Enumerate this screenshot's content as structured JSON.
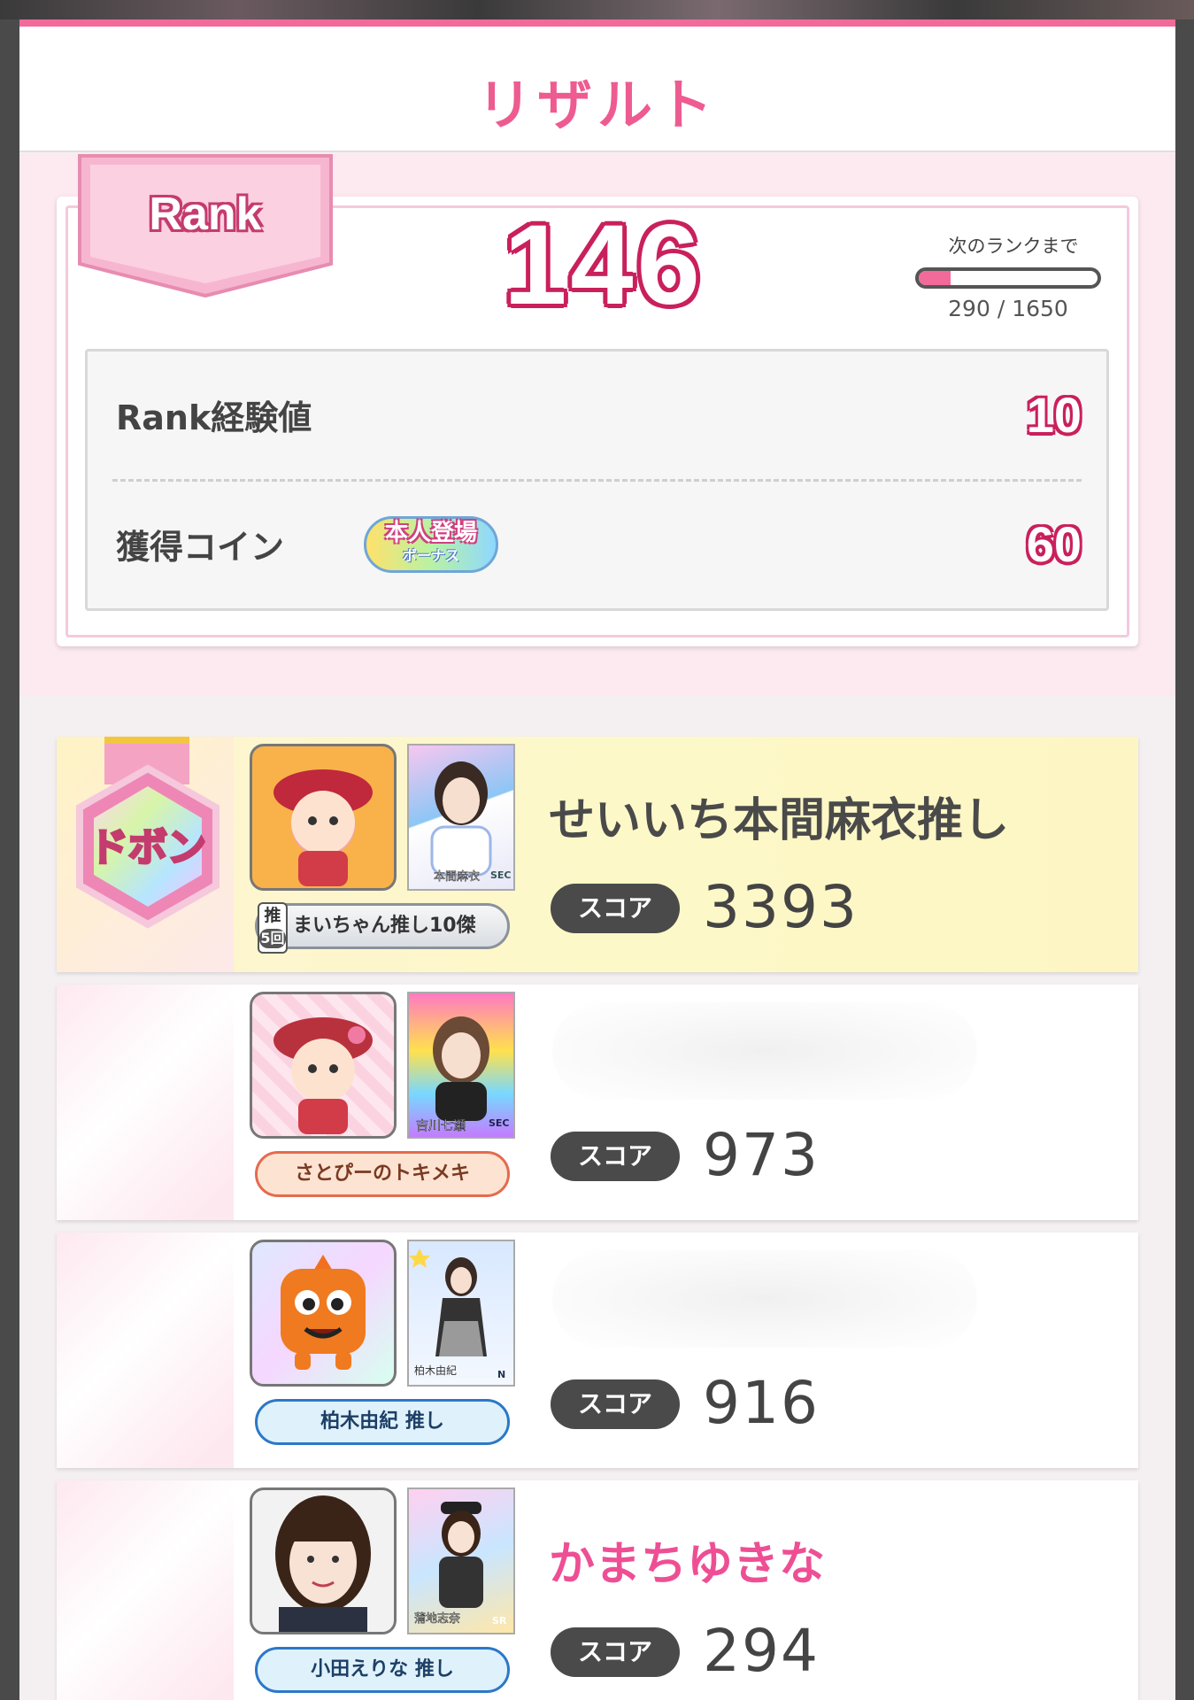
{
  "header": {
    "title": "リザルト"
  },
  "rank": {
    "badge_label": "Rank",
    "value": "146",
    "next_label": "次のランクまで",
    "next_progress": "290 / 1650",
    "next_fraction": 0.176
  },
  "stats": {
    "exp_label": "Rank経験値",
    "exp_value": "10",
    "coin_label": "獲得コイン",
    "bonus_top": "本人登場",
    "bonus_bottom": "ボーナス",
    "coin_value": "60"
  },
  "players": [
    {
      "medal": "ドボン",
      "name": "せいいち本間麻衣推し",
      "score_label": "スコア",
      "score": "3393",
      "oshi_tag": "まいちゃん推し10傑",
      "oshi_mark": "推",
      "oshi_count": "5回",
      "card_label": "本間麻衣",
      "card_rarity": "SEC"
    },
    {
      "name": "",
      "score_label": "スコア",
      "score": "973",
      "oshi_tag": "さとぴーのトキメキ",
      "card_label": "吉川七瀬",
      "card_rarity": "SEC"
    },
    {
      "name": "",
      "score_label": "スコア",
      "score": "916",
      "oshi_tag": "柏木由紀 推し",
      "card_label": "柏木由紀",
      "card_rarity": "N"
    },
    {
      "name": "かまちゆきな",
      "score_label": "スコア",
      "score": "294",
      "oshi_tag": "小田えりな 推し",
      "card_label": "蒲地志奈",
      "card_rarity": "SR"
    }
  ],
  "colors": {
    "accent": "#ee5b91",
    "rank_outline": "#c9205c",
    "score_pill": "#4a4a4a"
  }
}
